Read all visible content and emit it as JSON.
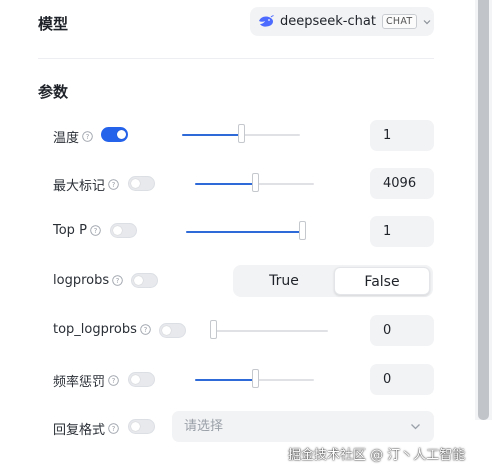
{
  "model": {
    "section_title": "模型",
    "selected_model": "deepseek-chat",
    "badge": "CHAT"
  },
  "params": {
    "section_title": "参数",
    "rows": [
      {
        "label": "温度",
        "enabled": true,
        "slider": 0.5,
        "value": "1"
      },
      {
        "label": "最大标记",
        "enabled": false,
        "slider": 0.5,
        "value": "4096"
      },
      {
        "label": "Top P",
        "enabled": false,
        "slider": 1.0,
        "value": "1"
      },
      {
        "label": "logprobs",
        "enabled": false
      },
      {
        "label": "top_logprobs",
        "enabled": false,
        "slider": 0.0,
        "value": "0"
      },
      {
        "label": "频率惩罚",
        "enabled": false,
        "slider": 0.5,
        "value": "0"
      },
      {
        "label": "回复格式",
        "enabled": false
      }
    ],
    "logprobs_options": [
      "True",
      "False"
    ],
    "logprobs_selected": "False",
    "response_format_placeholder": "请选择"
  },
  "colors": {
    "accent": "#2563eb",
    "slider_fill": "#2e6bd9",
    "input_bg": "#f2f3f5"
  },
  "watermark": "掘金技术社区 @ 汀丶人工智能"
}
